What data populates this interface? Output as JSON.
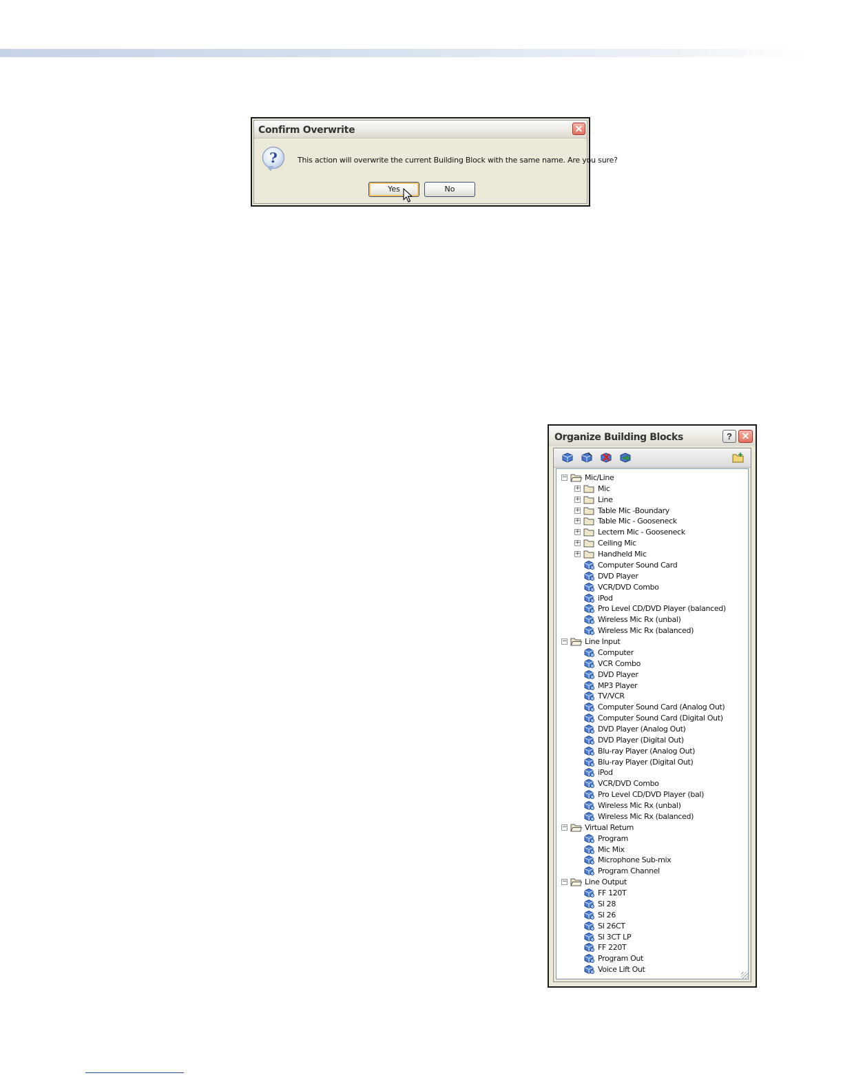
{
  "confirm_dialog": {
    "title": "Confirm Overwrite",
    "close_glyph": "✕",
    "icon": "question-icon",
    "icon_glyph": "?",
    "message": "This action will overwrite the current Building Block with the same name.  Are you sure?",
    "yes_label": "Yes",
    "no_label": "No"
  },
  "organize_panel": {
    "title": "Organize Building Blocks",
    "help_glyph": "?",
    "close_glyph": "✕",
    "toolbar_icons": [
      "add-block-icon",
      "edit-block-icon",
      "delete-block-icon",
      "import-block-icon",
      "new-folder-icon"
    ],
    "tree": [
      {
        "level": 0,
        "kind": "folder",
        "expanded": true,
        "label": "Mic/Line"
      },
      {
        "level": 1,
        "kind": "folder",
        "expanded": false,
        "label": "Mic"
      },
      {
        "level": 1,
        "kind": "folder",
        "expanded": false,
        "label": "Line"
      },
      {
        "level": 1,
        "kind": "folder",
        "expanded": false,
        "label": "Table Mic -Boundary"
      },
      {
        "level": 1,
        "kind": "folder",
        "expanded": false,
        "label": "Table Mic - Gooseneck"
      },
      {
        "level": 1,
        "kind": "folder",
        "expanded": false,
        "label": "Lectern Mic - Gooseneck"
      },
      {
        "level": 1,
        "kind": "folder",
        "expanded": false,
        "label": "Ceiling Mic"
      },
      {
        "level": 1,
        "kind": "folder",
        "expanded": false,
        "label": "Handheld Mic"
      },
      {
        "level": 1,
        "kind": "block",
        "label": "Computer Sound Card"
      },
      {
        "level": 1,
        "kind": "block",
        "label": "DVD Player"
      },
      {
        "level": 1,
        "kind": "block",
        "label": "VCR/DVD Combo"
      },
      {
        "level": 1,
        "kind": "block",
        "label": "iPod"
      },
      {
        "level": 1,
        "kind": "block",
        "label": "Pro Level CD/DVD Player (balanced)"
      },
      {
        "level": 1,
        "kind": "block",
        "label": "Wireless Mic Rx (unbal)"
      },
      {
        "level": 1,
        "kind": "block",
        "label": "Wireless Mic Rx (balanced)"
      },
      {
        "level": 0,
        "kind": "folder",
        "expanded": true,
        "label": "Line Input"
      },
      {
        "level": 1,
        "kind": "block",
        "label": "Computer"
      },
      {
        "level": 1,
        "kind": "block",
        "label": "VCR Combo"
      },
      {
        "level": 1,
        "kind": "block",
        "label": "DVD Player"
      },
      {
        "level": 1,
        "kind": "block",
        "label": "MP3 Player"
      },
      {
        "level": 1,
        "kind": "block",
        "label": "TV/VCR"
      },
      {
        "level": 1,
        "kind": "block",
        "label": "Computer Sound Card (Analog Out)"
      },
      {
        "level": 1,
        "kind": "block",
        "label": "Computer Sound Card (Digital Out)"
      },
      {
        "level": 1,
        "kind": "block",
        "label": "DVD Player (Analog Out)"
      },
      {
        "level": 1,
        "kind": "block",
        "label": "DVD Player (Digital Out)"
      },
      {
        "level": 1,
        "kind": "block",
        "label": "Blu-ray Player (Analog Out)"
      },
      {
        "level": 1,
        "kind": "block",
        "label": "Blu-ray Player (Digital Out)"
      },
      {
        "level": 1,
        "kind": "block",
        "label": "iPod"
      },
      {
        "level": 1,
        "kind": "block",
        "label": "VCR/DVD Combo"
      },
      {
        "level": 1,
        "kind": "block",
        "label": "Pro Level CD/DVD Player (bal)"
      },
      {
        "level": 1,
        "kind": "block",
        "label": "Wireless Mic Rx (unbal)"
      },
      {
        "level": 1,
        "kind": "block",
        "label": "Wireless Mic Rx (balanced)"
      },
      {
        "level": 0,
        "kind": "folder",
        "expanded": true,
        "label": "Virtual Return"
      },
      {
        "level": 1,
        "kind": "block",
        "label": "Program"
      },
      {
        "level": 1,
        "kind": "block",
        "label": "Mic Mix"
      },
      {
        "level": 1,
        "kind": "block",
        "label": "Microphone Sub-mix"
      },
      {
        "level": 1,
        "kind": "block",
        "label": "Program Channel"
      },
      {
        "level": 0,
        "kind": "folder",
        "expanded": true,
        "label": "Line Output"
      },
      {
        "level": 1,
        "kind": "block",
        "label": "FF 120T"
      },
      {
        "level": 1,
        "kind": "block",
        "label": "SI 28"
      },
      {
        "level": 1,
        "kind": "block",
        "label": "SI 26"
      },
      {
        "level": 1,
        "kind": "block",
        "label": "SI 26CT"
      },
      {
        "level": 1,
        "kind": "block",
        "label": "SI 3CT LP"
      },
      {
        "level": 1,
        "kind": "block",
        "label": "FF 220T"
      },
      {
        "level": 1,
        "kind": "block",
        "label": "Program Out"
      },
      {
        "level": 1,
        "kind": "block",
        "label": "Voice Lift Out"
      }
    ]
  }
}
